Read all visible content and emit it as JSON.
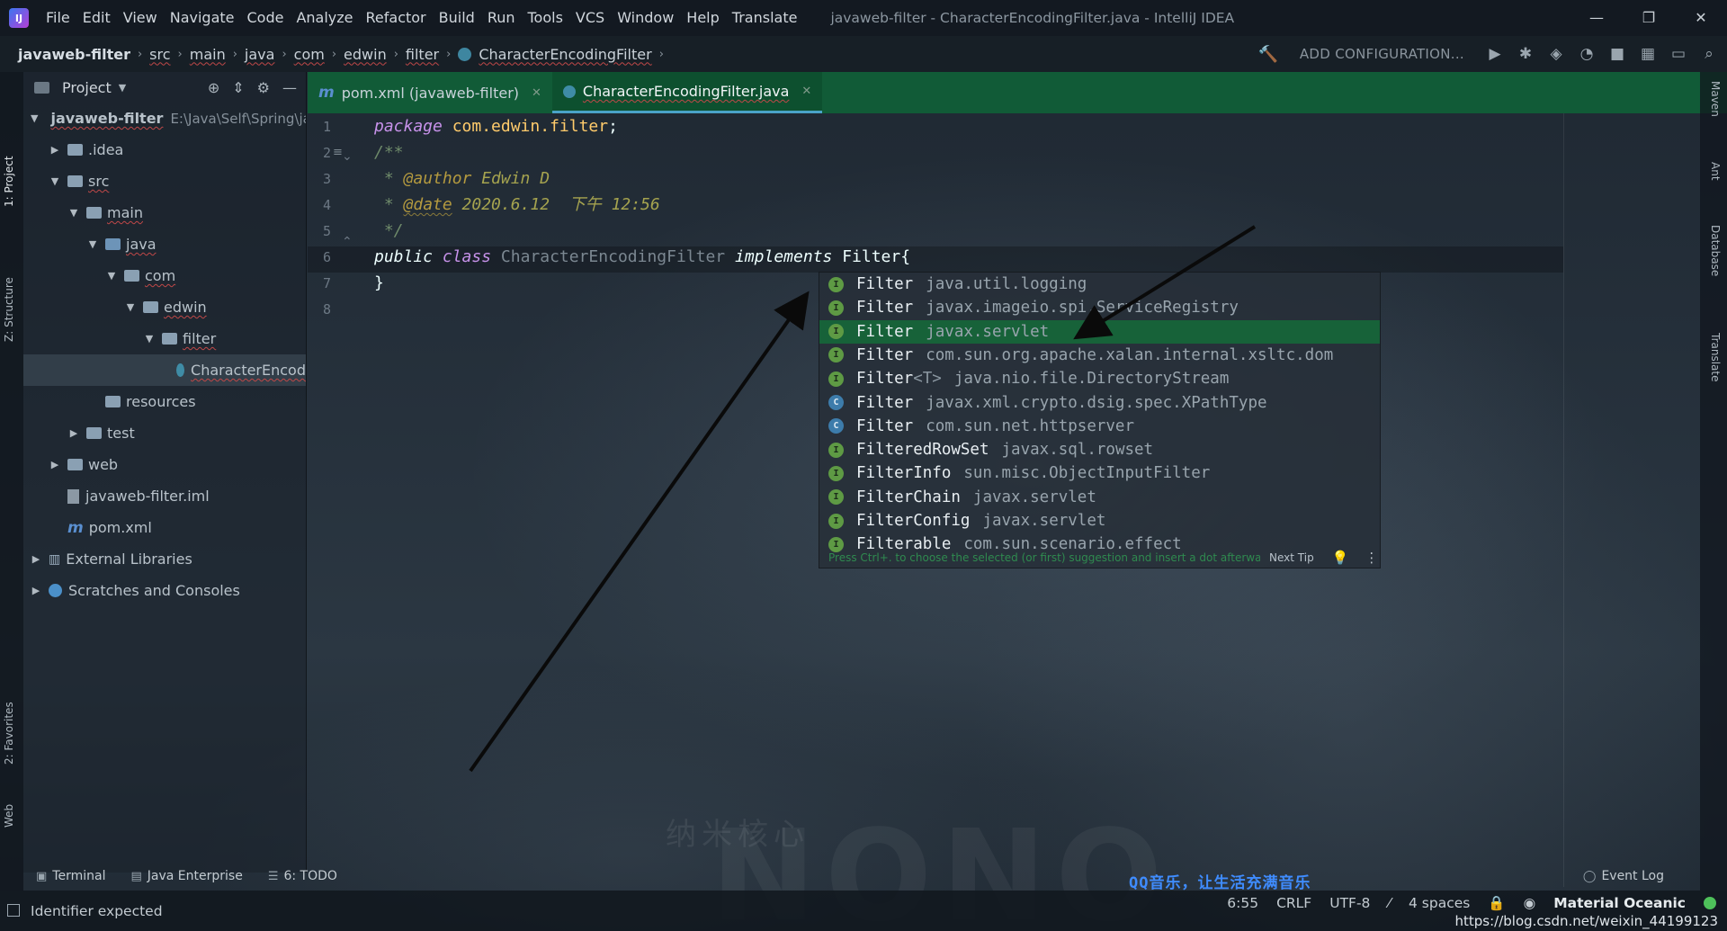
{
  "window": {
    "title": "javaweb-filter - CharacterEncodingFilter.java - IntelliJ IDEA",
    "logo": "IJ",
    "controls": [
      "—",
      "❐",
      "✕"
    ]
  },
  "menu": [
    "File",
    "Edit",
    "View",
    "Navigate",
    "Code",
    "Analyze",
    "Refactor",
    "Build",
    "Run",
    "Tools",
    "VCS",
    "Window",
    "Help",
    "Translate"
  ],
  "breadcrumbs": [
    "javaweb-filter",
    "src",
    "main",
    "java",
    "com",
    "edwin",
    "filter",
    "CharacterEncodingFilter"
  ],
  "toolbar": {
    "add_config": "ADD CONFIGURATION...",
    "icons": [
      "hammer-icon",
      "run-icon",
      "debug-icon",
      "coverage-icon",
      "profile-icon",
      "stop-icon",
      "project-structure-icon",
      "window-icon",
      "search-icon"
    ]
  },
  "left_strip": {
    "tabs": [
      "1: Project",
      "Z: Structure",
      "2: Favorites",
      "Web"
    ]
  },
  "right_strip": {
    "tabs": [
      "Maven",
      "Ant",
      "Database",
      "Translate"
    ]
  },
  "project_panel": {
    "title": "Project",
    "tree": [
      {
        "label": "javaweb-filter",
        "extra": "E:\\Java\\Self\\Spring\\ja",
        "depth": 0,
        "expanded": true,
        "icon": "folder-module",
        "underline": true,
        "bold": false
      },
      {
        "label": ".idea",
        "depth": 1,
        "expanded": false,
        "icon": "folder"
      },
      {
        "label": "src",
        "depth": 1,
        "expanded": true,
        "icon": "folder",
        "underline": true
      },
      {
        "label": "main",
        "depth": 2,
        "expanded": true,
        "icon": "folder",
        "underline": true
      },
      {
        "label": "java",
        "depth": 3,
        "expanded": true,
        "icon": "folder-blue",
        "underline": true
      },
      {
        "label": "com",
        "depth": 4,
        "expanded": true,
        "icon": "folder-package",
        "underline": true
      },
      {
        "label": "edwin",
        "depth": 5,
        "expanded": true,
        "icon": "folder-package",
        "underline": true
      },
      {
        "label": "filter",
        "depth": 6,
        "expanded": true,
        "icon": "folder-package",
        "underline": true
      },
      {
        "label": "CharacterEncod",
        "depth": 7,
        "icon": "class",
        "underline": true,
        "selected": true
      },
      {
        "label": "resources",
        "depth": 3,
        "icon": "folder-res"
      },
      {
        "label": "test",
        "depth": 2,
        "expanded": false,
        "icon": "folder"
      },
      {
        "label": "web",
        "depth": 1,
        "expanded": false,
        "icon": "folder-web"
      },
      {
        "label": "javaweb-filter.iml",
        "depth": 1,
        "icon": "iml"
      },
      {
        "label": "pom.xml",
        "depth": 1,
        "icon": "maven"
      },
      {
        "label": "External Libraries",
        "depth": 0,
        "expanded": false,
        "icon": "library"
      },
      {
        "label": "Scratches and Consoles",
        "depth": 0,
        "expanded": false,
        "icon": "scratch"
      }
    ]
  },
  "tabs": [
    {
      "label": "pom.xml (javaweb-filter)",
      "icon": "m",
      "active": false
    },
    {
      "label": "CharacterEncodingFilter.java",
      "icon": "c",
      "active": true
    }
  ],
  "editor": {
    "line_numbers": [
      "1",
      "2",
      "3",
      "4",
      "5",
      "6",
      "7",
      "8"
    ],
    "code": {
      "l1_kw": "package",
      "l1_pkg": " com.edwin.filter",
      "l1_end": ";",
      "l2": "/**",
      "l3_star": " * ",
      "l3_tag": "@author",
      "l3_val": " Edwin D",
      "l4_star": " * ",
      "l4_tag": "@date",
      "l4_val": " 2020.6.12  下午 12:56",
      "l5": " */",
      "l6_kw1": "public",
      "l6_kw2": " class",
      "l6_cls": " CharacterEncodingFilter",
      "l6_kw3": " implements",
      "l6_txt": " Filter{",
      "l7": "}"
    }
  },
  "completion": {
    "items": [
      {
        "name": "Filter",
        "generic": "",
        "pkg": "java.util.logging",
        "kind": "iface",
        "selected": false
      },
      {
        "name": "Filter",
        "generic": "",
        "pkg": "javax.imageio.spi.ServiceRegistry",
        "kind": "iface",
        "selected": false
      },
      {
        "name": "Filter",
        "generic": "",
        "pkg": "javax.servlet",
        "kind": "iface",
        "selected": true
      },
      {
        "name": "Filter",
        "generic": "",
        "pkg": "com.sun.org.apache.xalan.internal.xsltc.dom",
        "kind": "iface",
        "selected": false
      },
      {
        "name": "Filter",
        "generic": "<T>",
        "pkg": "java.nio.file.DirectoryStream",
        "kind": "iface",
        "selected": false
      },
      {
        "name": "Filter",
        "generic": "",
        "pkg": "javax.xml.crypto.dsig.spec.XPathType",
        "kind": "cls",
        "selected": false
      },
      {
        "name": "Filter",
        "generic": "",
        "pkg": "com.sun.net.httpserver",
        "kind": "cls",
        "selected": false
      },
      {
        "name": "FilteredRowSet",
        "generic": "",
        "pkg": "javax.sql.rowset",
        "kind": "iface",
        "selected": false
      },
      {
        "name": "FilterInfo",
        "generic": "",
        "pkg": "sun.misc.ObjectInputFilter",
        "kind": "iface",
        "selected": false
      },
      {
        "name": "FilterChain",
        "generic": "",
        "pkg": "javax.servlet",
        "kind": "iface",
        "selected": false
      },
      {
        "name": "FilterConfig",
        "generic": "",
        "pkg": "javax.servlet",
        "kind": "iface",
        "selected": false
      },
      {
        "name": "Filterable",
        "generic": "",
        "pkg": "com.sun.scenario.effect",
        "kind": "iface",
        "selected": false
      }
    ],
    "tip": "Press Ctrl+. to choose the selected (or first) suggestion and insert a dot afterwards",
    "next_tip": "Next Tip"
  },
  "bottom_bar": {
    "terminal": "Terminal",
    "java_enterprise": "Java Enterprise",
    "todo": "6: TODO",
    "event_log": "Event Log"
  },
  "qq_banner": "QQ音乐，让生活充满音乐",
  "watermark": {
    "big": "NONO",
    "cn": "纳米核心"
  },
  "status": {
    "message": "Identifier expected",
    "position": "6:55",
    "line_sep": "CRLF",
    "encoding": "UTF-8",
    "indent": "4 spaces",
    "theme": "Material Oceanic",
    "url": "https://blog.csdn.net/weixin_44199123"
  }
}
